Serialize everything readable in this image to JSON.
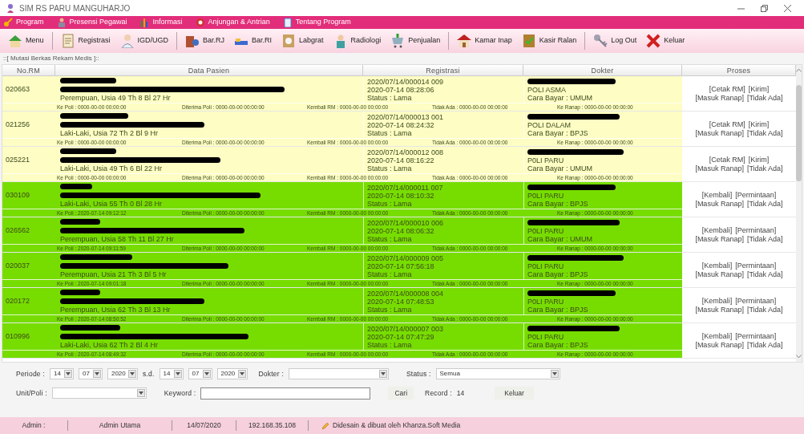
{
  "window": {
    "title": "SIM RS PARU MANGUHARJO"
  },
  "menu_bar": [
    "Program",
    "Presensi Pegawai",
    "Informasi",
    "Anjungan & Antrian",
    "Tentang Program"
  ],
  "toolbar": [
    {
      "label": "Menu",
      "separator_after": true
    },
    {
      "label": "Registrasi",
      "separator_after": false
    },
    {
      "label": "IGD/UGD",
      "separator_after": true
    },
    {
      "label": "Bar.RJ",
      "separator_after": false
    },
    {
      "label": "Bar.RI",
      "separator_after": false
    },
    {
      "label": "Labgrat",
      "separator_after": false
    },
    {
      "label": "Radiologi",
      "separator_after": false
    },
    {
      "label": "Penjualan",
      "separator_after": true
    },
    {
      "label": "Kamar Inap",
      "separator_after": false
    },
    {
      "label": "Kasir Ralan",
      "separator_after": true
    },
    {
      "label": "Log Out",
      "separator_after": false
    },
    {
      "label": "Keluar",
      "separator_after": false
    }
  ],
  "panel_title": "::[ Mutasi Berkas Rekam Medis ]::",
  "table": {
    "columns": [
      "No.RM",
      "Data Pasien",
      "Registrasi",
      "Dokter",
      "Proses"
    ],
    "rows": [
      {
        "no_rm": "020663",
        "color": "#fdfdc4",
        "patient": "Perempuan, Usia 49 Th 8 Bl 27 Hr",
        "registration": [
          "2020/07/14/000014 009",
          "2020-07-14 08:28:06",
          "Status : Lama"
        ],
        "doctor": [
          "POLI ASMA",
          "Cara Bayar : UMUM"
        ],
        "times": [
          "Ke Poli : 0000-00-00 00:00:00",
          "Diterima Poli : 0000-00-00 00:00:00",
          "Kembali RM : 0000-00-00 00:00:00",
          "Tidak Ada : 0000-00-00 00:00:00",
          "Ke Ranap : 0000-00-00 00:00:00"
        ],
        "actions": [
          [
            "[Cetak RM]",
            "[Kirim]"
          ],
          [
            "[Masuk Ranap]",
            "[Tidak Ada]"
          ]
        ]
      },
      {
        "no_rm": "021256",
        "color": "#fdfdc4",
        "patient": "Laki-Laki, Usia 72 Th 2 Bl 9 Hr",
        "registration": [
          "2020/07/14/000013 001",
          "2020-07-14 08:24:32",
          "Status : Lama"
        ],
        "doctor": [
          "POLI DALAM",
          "Cara Bayar : BPJS"
        ],
        "times": [
          "Ke Poli : 0000-00-00 00:00:00",
          "Diterima Poli : 0000-00-00 00:00:00",
          "Kembali RM : 0000-00-00 00:00:00",
          "Tidak Ada : 0000-00-00 00:00:00",
          "Ke Ranap : 0000-00-00 00:00:00"
        ],
        "actions": [
          [
            "[Cetak RM]",
            "[Kirim]"
          ],
          [
            "[Masuk Ranap]",
            "[Tidak Ada]"
          ]
        ]
      },
      {
        "no_rm": "025221",
        "color": "#fdfdc4",
        "patient": "Laki-Laki, Usia 49 Th 6 Bl 22 Hr",
        "registration": [
          "2020/07/14/000012 008",
          "2020-07-14 08:16:22",
          "Status : Lama"
        ],
        "doctor": [
          "P0LI PARU",
          "Cara Bayar : UMUM"
        ],
        "times": [
          "Ke Poli : 0000-00-00 00:00:00",
          "Diterima Poli : 0000-00-00 00:00:00",
          "Kembali RM : 0000-00-00 00:00:00",
          "Tidak Ada : 0000-00-00 00:00:00",
          "Ke Ranap : 0000-00-00 00:00:00"
        ],
        "actions": [
          [
            "[Cetak RM]",
            "[Kirim]"
          ],
          [
            "[Masuk Ranap]",
            "[Tidak Ada]"
          ]
        ]
      },
      {
        "no_rm": "030109",
        "color": "#77dd00",
        "patient": "Laki-Laki, Usia 55 Th 0 Bl 28 Hr",
        "registration": [
          "2020/07/14/000011 007",
          "2020-07-14 08:10:32",
          "Status : Lama"
        ],
        "doctor": [
          "P0LI PARU",
          "Cara Bayar : BPJS"
        ],
        "times": [
          "Ke Poli : 2020-07-14 09:12:12",
          "Diterima Poli : 0000-00-00 00:00:00",
          "Kembali RM : 0000-00-00 00:00:00",
          "Tidak Ada : 0000-00-00 00:00:00",
          "Ke Ranap : 0000-00-00 00:00:00"
        ],
        "actions": [
          [
            "[Kembali]",
            "[Permintaan]"
          ],
          [
            "[Masuk Ranap]",
            "[Tidak Ada]"
          ]
        ]
      },
      {
        "no_rm": "026562",
        "color": "#77dd00",
        "patient": "Perempuan, Usia 58 Th 11 Bl 27 Hr",
        "registration": [
          "2020/07/14/000010 006",
          "2020-07-14 08:06:32",
          "Status : Lama"
        ],
        "doctor": [
          "P0LI PARU",
          "Cara Bayar : UMUM"
        ],
        "times": [
          "Ke Poli : 2020-07-14 09:11:59",
          "Diterima Poli : 0000-00-00 00:00:00",
          "Kembali RM : 0000-00-00 00:00:00",
          "Tidak Ada : 0000-00-00 00:00:00",
          "Ke Ranap : 0000-00-00 00:00:00"
        ],
        "actions": [
          [
            "[Kembali]",
            "[Permintaan]"
          ],
          [
            "[Masuk Ranap]",
            "[Tidak Ada]"
          ]
        ]
      },
      {
        "no_rm": "020037",
        "color": "#77dd00",
        "patient": "Perempuan, Usia 21 Th 3 Bl 5 Hr",
        "registration": [
          "2020/07/14/000009 005",
          "2020-07-14 07:56:18",
          "Status : Lama"
        ],
        "doctor": [
          "P0LI PARU",
          "Cara Bayar : BPJS"
        ],
        "times": [
          "Ke Poli : 2020-07-14 09:01:18",
          "Diterima Poli : 0000-00-00 00:00:00",
          "Kembali RM : 0000-00-00 00:00:00",
          "Tidak Ada : 0000-00-00 00:00:00",
          "Ke Ranap : 0000-00-00 00:00:00"
        ],
        "actions": [
          [
            "[Kembali]",
            "[Permintaan]"
          ],
          [
            "[Masuk Ranap]",
            "[Tidak Ada]"
          ]
        ]
      },
      {
        "no_rm": "020172",
        "color": "#77dd00",
        "patient": "Perempuan, Usia 62 Th 3 Bl 13 Hr",
        "registration": [
          "2020/07/14/000008 004",
          "2020-07-14 07:48:53",
          "Status : Lama"
        ],
        "doctor": [
          "P0LI PARU",
          "Cara Bayar : BPJS"
        ],
        "times": [
          "Ke Poli : 2020-07-14 08:50:52",
          "Diterima Poli : 0000-00-00 00:00:00",
          "Kembali RM : 0000-00-00 00:00:00",
          "Tidak Ada : 0000-00-00 00:00:00",
          "Ke Ranap : 0000-00-00 00:00:00"
        ],
        "actions": [
          [
            "[Kembali]",
            "[Permintaan]"
          ],
          [
            "[Masuk Ranap]",
            "[Tidak Ada]"
          ]
        ]
      },
      {
        "no_rm": "010996",
        "color": "#77dd00",
        "patient": "Laki-Laki, Usia 62 Th 2 Bl 4 Hr",
        "registration": [
          "2020/07/14/000007 003",
          "2020-07-14 07:47:29",
          "Status : Lama"
        ],
        "doctor": [
          "P0LI PARU",
          "Cara Bayar : BPJS"
        ],
        "times": [
          "Ke Poli : 2020-07-14 08:49:32",
          "Diterima Poli : 0000-00-00 00:00:00",
          "Kembali RM : 0000-00-00 00:00:00",
          "Tidak Ada : 0000-00-00 00:00:00",
          "Ke Ranap : 0000-00-00 00:00:00"
        ],
        "actions": [
          [
            "[Kembali]",
            "[Permintaan]"
          ],
          [
            "[Masuk Ranap]",
            "[Tidak Ada]"
          ]
        ]
      }
    ]
  },
  "filters": {
    "periode_label": "Periode :",
    "from": [
      "14",
      "07",
      "2020"
    ],
    "sd_label": "s.d.",
    "to": [
      "14",
      "07",
      "2020"
    ],
    "dokter_label": "Dokter :",
    "status_label": "Status :",
    "status_value": "Semua",
    "unit_label": "Unit/Poli :",
    "keyword_label": "Keyword :",
    "search_button": "Cari",
    "record_label": "Record :",
    "record_value": "14",
    "exit_button": "Keluar"
  },
  "status_bar": [
    "Admin :",
    "Admin Utama",
    "14/07/2020",
    "192.168.35.108",
    "Didesain & dibuat oleh Khanza.Soft Media"
  ]
}
